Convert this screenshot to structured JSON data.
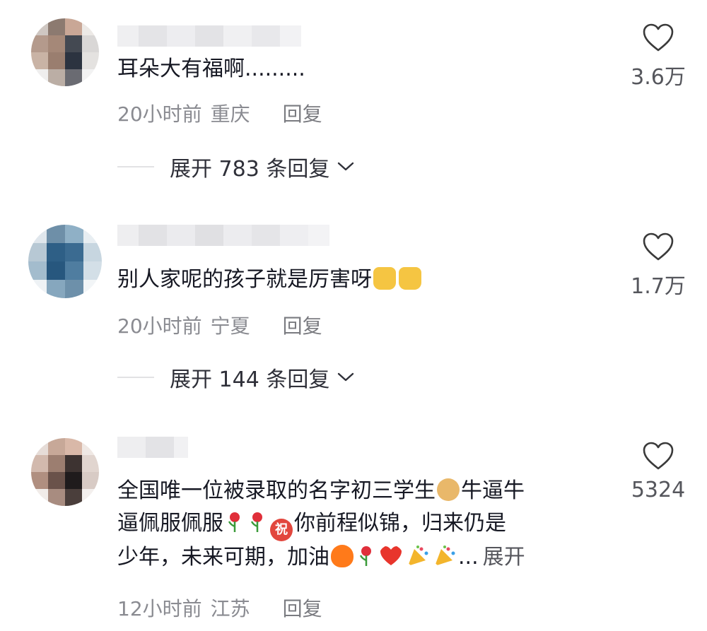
{
  "comments": [
    {
      "text": "耳朵大有福啊.........",
      "time": "20小时前",
      "location": "重庆",
      "reply_label": "回复",
      "expand_text": "展开 783 条回复",
      "likes": "3.6万",
      "username_blurred": true
    },
    {
      "text": "别人家呢的孩子就是厉害呀",
      "emojis": [
        "thumbs-up",
        "thumbs-up"
      ],
      "time": "20小时前",
      "location": "宁夏",
      "reply_label": "回复",
      "expand_text": "展开 144 条回复",
      "likes": "1.7万",
      "username_blurred": true
    },
    {
      "text_line1": "全国唯一位被录取的名字初三学生",
      "text_line1b": "牛逼牛",
      "text_line2a": "逼佩服佩服",
      "text_line2b": "你前程似锦，归来仍是",
      "text_line3a": "少年，未来可期，加油",
      "text_line3b": "...",
      "inline_expand": "展开",
      "zhu_char": "祝",
      "time": "12小时前",
      "location": "江苏",
      "reply_label": "回复",
      "likes": "5324",
      "username_blurred": true
    }
  ],
  "colors": {
    "text_primary": "#161823",
    "text_secondary": "#8a8b91",
    "heart_outline": "#3a3a3a"
  }
}
